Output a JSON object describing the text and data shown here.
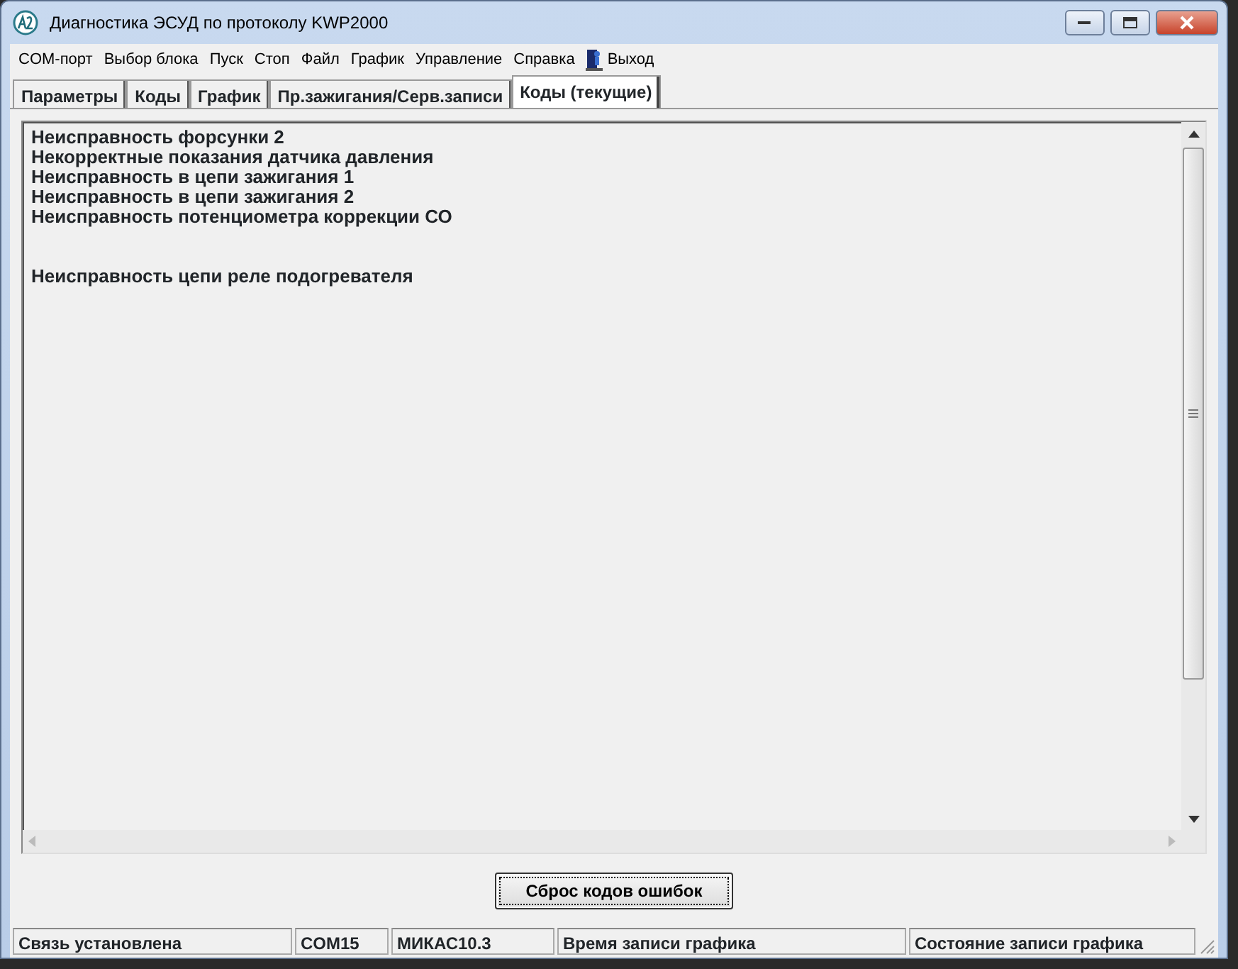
{
  "window": {
    "title": "Диагностика ЭСУД по протоколу KWP2000"
  },
  "menu": [
    {
      "label": "COM-порт",
      "kind": "text"
    },
    {
      "label": "Выбор блока",
      "kind": "text"
    },
    {
      "label": "Пуск",
      "kind": "text"
    },
    {
      "label": "Стоп",
      "kind": "text"
    },
    {
      "label": "Файл",
      "kind": "text"
    },
    {
      "label": "График",
      "kind": "text"
    },
    {
      "label": "Управление",
      "kind": "text"
    },
    {
      "label": "Справка",
      "kind": "text"
    },
    {
      "label": "Выход",
      "kind": "exit"
    }
  ],
  "tabs": [
    {
      "label": "Параметры",
      "selected": false
    },
    {
      "label": "Коды",
      "selected": false
    },
    {
      "label": "График",
      "selected": false
    },
    {
      "label": "Пр.зажигания/Серв.записи",
      "selected": false
    },
    {
      "label": "Коды (текущие)",
      "selected": true
    }
  ],
  "code_blocks": [
    {
      "lines": [
        "Неисправность форсунки 2",
        "Некорректные показания датчика давления",
        "Неисправность в цепи зажигания 1",
        "Неисправность в цепи зажигания 2",
        "Неисправность потенциометра коррекции СО"
      ]
    },
    {
      "lines": [
        "Неисправность цепи реле подогревателя"
      ]
    }
  ],
  "reset_button": "Сброс кодов ошибок",
  "status_bar": [
    "Связь установлена",
    "COM15",
    "МИКАС10.3",
    "Время записи графика",
    "Состояние записи графика"
  ]
}
